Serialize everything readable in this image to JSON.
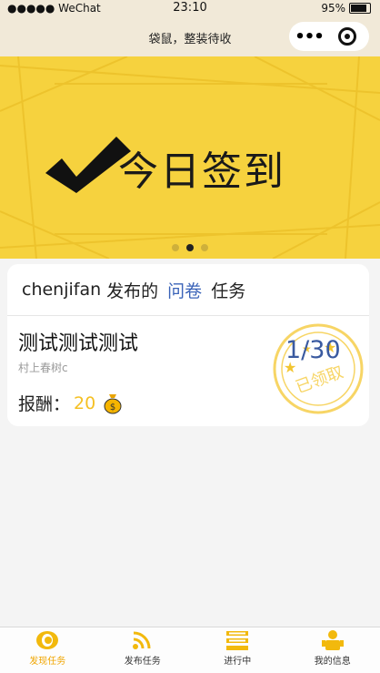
{
  "status_bar": {
    "signal": "●●●●● WeChat",
    "time": "23:10",
    "battery": "95%"
  },
  "nav": {
    "title": "袋鼠，整装待收",
    "more_icon": "more-dots-icon",
    "close_icon": "close-circle-icon"
  },
  "banner": {
    "text": "今日签到",
    "check_icon": "checkmark-icon",
    "dot_count": 3,
    "active_dot": 2,
    "background_color": "#f6d23e"
  },
  "task_card": {
    "publisher": "chenjifan",
    "published_word": "发布的",
    "type": "问卷",
    "task_word": "任务",
    "title": "测试测试测试",
    "author": "村上春树c",
    "reward_label": "报酬：",
    "reward_amount": "20",
    "reward_icon": "money-bag-icon",
    "count": "1/30",
    "stamp_text": "已领取",
    "type_color": "#3a63b8",
    "amount_color": "#f5c024"
  },
  "tab_bar": {
    "active_index": 0,
    "active_color": "#f0a500",
    "items": [
      {
        "label": "发现任务",
        "icon": "eye-icon"
      },
      {
        "label": "发布任务",
        "icon": "rss-icon"
      },
      {
        "label": "进行中",
        "icon": "list-icon"
      },
      {
        "label": "我的信息",
        "icon": "user-icon"
      }
    ]
  }
}
